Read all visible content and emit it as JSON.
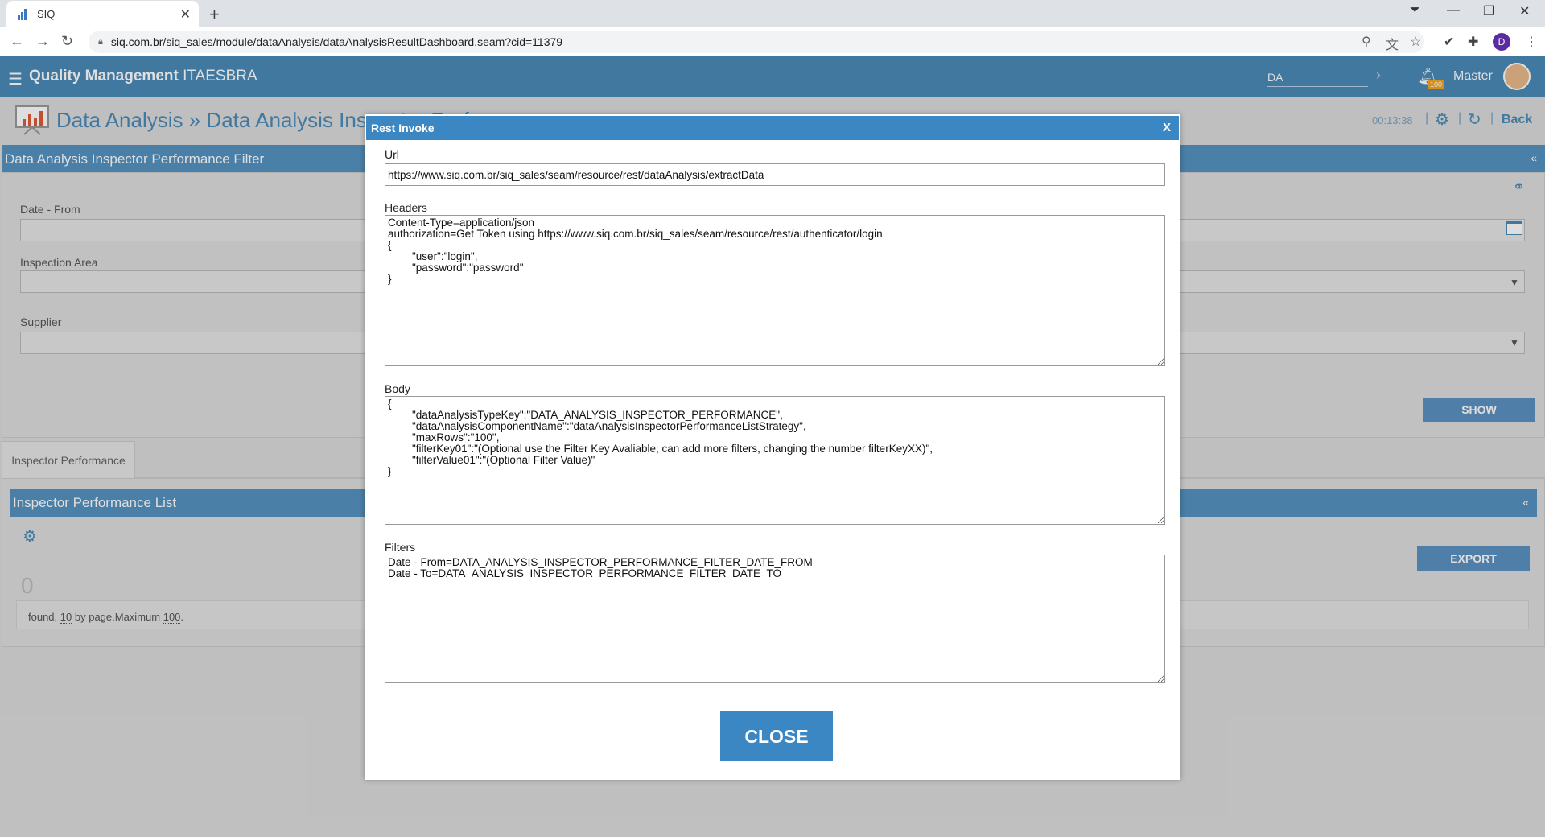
{
  "browser": {
    "tab_title": "SIQ",
    "url": "siq.com.br/siq_sales/module/dataAnalysis/dataAnalysisResultDashboard.seam?cid=11379",
    "profile_initial": "D"
  },
  "app": {
    "brand_bold": "Quality Management",
    "brand_rest": "ITAESBRA",
    "search_value": "DA",
    "notification_count": "100",
    "user_name": "Master"
  },
  "page": {
    "title": "Data Analysis » Data Analysis Inspector Performance",
    "timer": "00:13:38",
    "back_label": "Back"
  },
  "filter": {
    "panel_title": "Data Analysis Inspector Performance Filter",
    "date_from_label": "Date - From",
    "inspection_area_label": "Inspection Area",
    "supplier_label": "Supplier",
    "show_label": "SHOW"
  },
  "list": {
    "tab_label": "Inspector Performance",
    "panel_title": "Inspector Performance List",
    "count": "0",
    "found_text": "found,",
    "page_size": "10",
    "by_page_text": "by page.Maximum",
    "maximum": "100",
    "export_label": "EXPORT"
  },
  "modal": {
    "title": "Rest Invoke",
    "close_x": "X",
    "url_label": "Url",
    "url_value": "https://www.siq.com.br/siq_sales/seam/resource/rest/dataAnalysis/extractData",
    "headers_label": "Headers",
    "headers_value": "Content-Type=application/json\nauthorization=Get Token using https://www.siq.com.br/siq_sales/seam/resource/rest/authenticator/login\n{\n        \"user\":\"login\",\n        \"password\":\"password\"\n}",
    "body_label": "Body",
    "body_value": "{\n        \"dataAnalysisTypeKey\":\"DATA_ANALYSIS_INSPECTOR_PERFORMANCE\",\n        \"dataAnalysisComponentName\":\"dataAnalysisInspectorPerformanceListStrategy\",\n        \"maxRows\":\"100\",\n        \"filterKey01\":\"(Optional use the Filter Key Avaliable, can add more filters, changing the number filterKeyXX)\",\n        \"filterValue01\":\"(Optional Filter Value)\"\n}",
    "filters_label": "Filters",
    "filters_value": "Date - From=DATA_ANALYSIS_INSPECTOR_PERFORMANCE_FILTER_DATE_FROM\nDate - To=DATA_ANALYSIS_INSPECTOR_PERFORMANCE_FILTER_DATE_TO",
    "close_label": "CLOSE"
  }
}
